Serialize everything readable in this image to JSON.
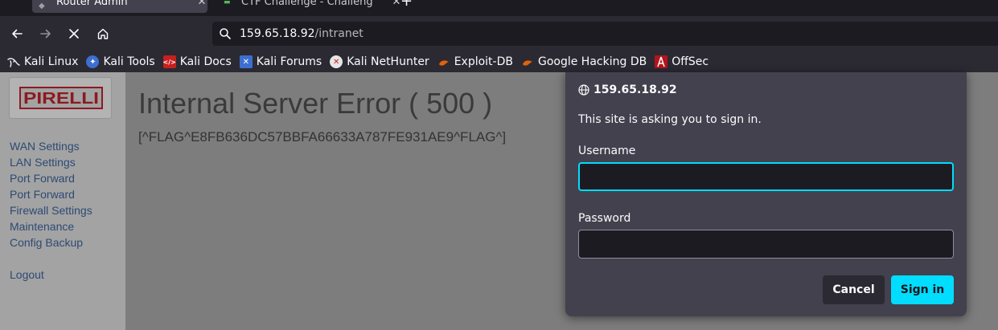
{
  "tabs": [
    {
      "title": "Router Admin",
      "active": true
    },
    {
      "title": "CTF Challenge - Challeng",
      "active": false
    }
  ],
  "new_tab": "+",
  "tab_close": "✕",
  "url": {
    "host": "159.65.18.92",
    "path": "/intranet"
  },
  "bookmarks": [
    {
      "label": "Kali Linux",
      "icon": "kali-dragon-icon",
      "color": "#e6e6e6"
    },
    {
      "label": "Kali Tools",
      "icon": "kali-tools-icon",
      "color": "#3d6fd1"
    },
    {
      "label": "Kali Docs",
      "icon": "kali-docs-icon",
      "color": "#c8201f"
    },
    {
      "label": "Kali Forums",
      "icon": "kali-forums-icon",
      "color": "#3d6fd1"
    },
    {
      "label": "Kali NetHunter",
      "icon": "kali-nethunter-icon",
      "color": "#c8201f"
    },
    {
      "label": "Exploit-DB",
      "icon": "exploit-db-icon",
      "color": "#e36209"
    },
    {
      "label": "Google Hacking DB",
      "icon": "ghdb-icon",
      "color": "#e36209"
    },
    {
      "label": "OffSec",
      "icon": "offsec-icon",
      "color": "#b5141c"
    }
  ],
  "sidebar": {
    "logo": "PIRELLI",
    "links": [
      "WAN Settings",
      "LAN Settings",
      "Port Forward",
      "Port Forward",
      "Firewall Settings",
      "Maintenance",
      "Config Backup"
    ],
    "logout": "Logout"
  },
  "main": {
    "title": "Internal Server Error ( 500 )",
    "flag": "[^FLAG^E8FB636DC57BBFA66633A787FE931AE9^FLAG^]"
  },
  "dialog": {
    "host": "159.65.18.92",
    "message": "This site is asking you to sign in.",
    "username_label": "Username",
    "username_value": "",
    "password_label": "Password",
    "password_value": "",
    "cancel_label": "Cancel",
    "signin_label": "Sign in"
  },
  "colors": {
    "accent": "#00ddff",
    "link": "#2d4a73",
    "logo_red": "#d2232a"
  }
}
